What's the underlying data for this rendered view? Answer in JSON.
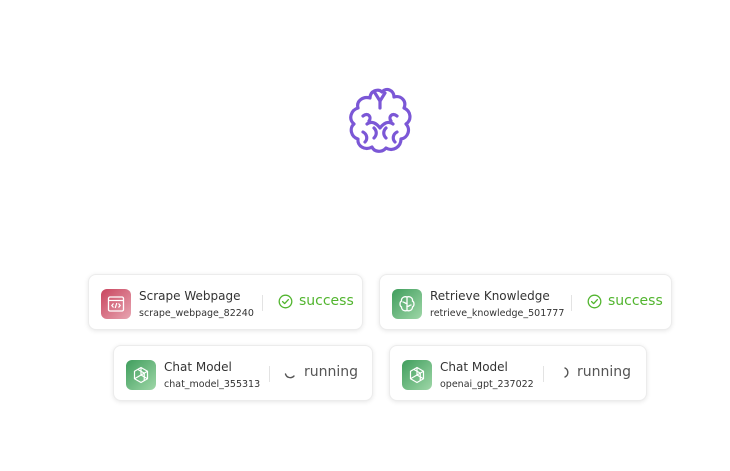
{
  "colors": {
    "brain_logo": "#7b57d6",
    "success": "#52b52f",
    "running_text": "#555555",
    "scrape_icon_bg": "#d0566c",
    "knowledge_icon_bg": "#4fa765"
  },
  "logo": {
    "icon": "brain-icon"
  },
  "nodes": [
    {
      "title": "Scrape Webpage",
      "id": "scrape_webpage_82240",
      "icon": "code-window-icon",
      "status": "success",
      "status_icon": "check-circle-icon"
    },
    {
      "title": "Retrieve Knowledge",
      "id": "retrieve_knowledge_501777",
      "icon": "brain-icon",
      "status": "success",
      "status_icon": "check-circle-icon"
    },
    {
      "title": "Chat Model",
      "id": "chat_model_355313",
      "icon": "openai-icon",
      "status": "running",
      "status_icon": "spinner-icon"
    },
    {
      "title": "Chat Model",
      "id": "openai_gpt_237022",
      "icon": "openai-icon",
      "status": "running",
      "status_icon": "spinner-icon"
    }
  ]
}
